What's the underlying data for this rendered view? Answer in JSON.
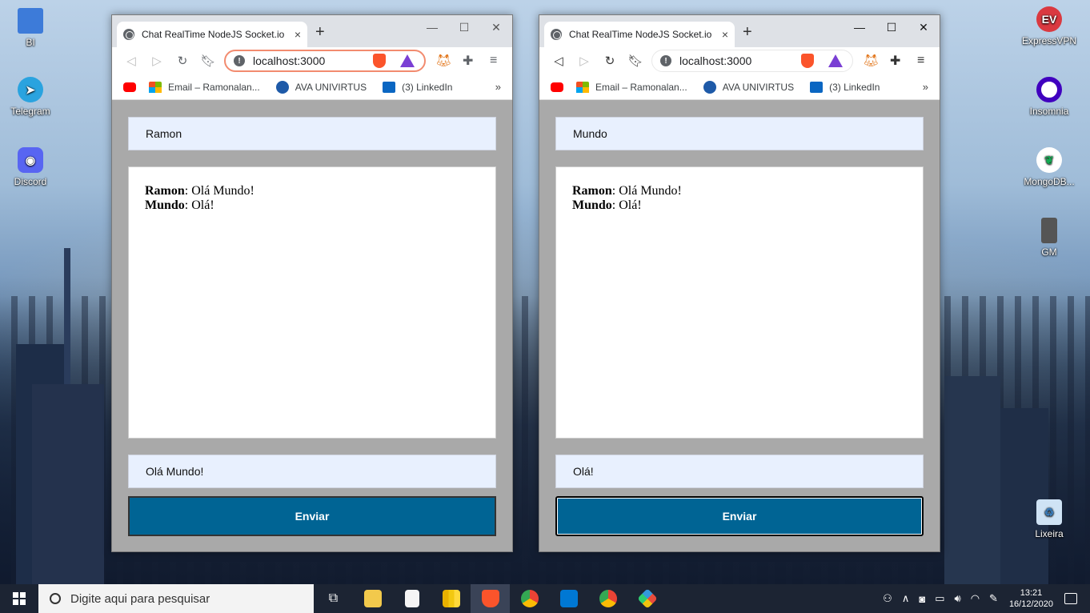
{
  "desktop": {
    "left_icons": [
      {
        "label": "BI",
        "icon": "bi-shortcut-icon",
        "color": "#3d7bd9"
      },
      {
        "label": "Telegram",
        "icon": "telegram-icon",
        "color": "#2aa3df"
      },
      {
        "label": "Discord",
        "icon": "discord-icon",
        "color": "#5865f2"
      }
    ],
    "right_icons": [
      {
        "label": "ExpressVPN",
        "icon": "expressvpn-icon",
        "color": "#da3940"
      },
      {
        "label": "Insomnia",
        "icon": "insomnia-icon",
        "color": "#4000bf"
      },
      {
        "label": "MongoDB...",
        "icon": "mongodb-icon",
        "color": "#13aa52"
      },
      {
        "label": "GM",
        "icon": "gm-icon",
        "color": "#555555"
      },
      {
        "label": "Lixeira",
        "icon": "recycle-bin-icon",
        "color": "#7fb3d9"
      }
    ]
  },
  "browser": {
    "tab_title": "Chat RealTime NodeJS Socket.io",
    "tab_close": "×",
    "new_tab": "+",
    "url": "localhost:3000",
    "bookmarks": [
      {
        "label": "Email – Ramonalan...",
        "icon": "microsoft-icon"
      },
      {
        "label": "AVA UNIVIRTUS",
        "icon": "ava-icon"
      },
      {
        "label": "(3) LinkedIn",
        "icon": "linkedin-icon"
      }
    ],
    "bookmarks_more": "»",
    "accent_brave": "#fb542b"
  },
  "left_window": {
    "name_value": "Ramon",
    "messages": [
      {
        "author": "Ramon",
        "text": ": Olá Mundo!"
      },
      {
        "author": "Mundo",
        "text": ": Olá!"
      }
    ],
    "message_value": "Olá Mundo!",
    "send_label": "Enviar"
  },
  "right_window": {
    "name_value": "Mundo",
    "messages": [
      {
        "author": "Ramon",
        "text": ": Olá Mundo!"
      },
      {
        "author": "Mundo",
        "text": ": Olá!"
      }
    ],
    "message_value": "Olá!",
    "send_label": "Enviar"
  },
  "taskbar": {
    "search_placeholder": "Digite aqui para pesquisar",
    "apps": [
      "task-view-icon",
      "file-explorer-icon",
      "notepad-icon",
      "power-bi-icon",
      "brave-icon",
      "chrome-icon",
      "vscode-icon",
      "chrome-profile-icon",
      "git-kraken-icon"
    ],
    "time": "13:21",
    "date": "16/12/2020",
    "send_button_color": "#006494"
  }
}
